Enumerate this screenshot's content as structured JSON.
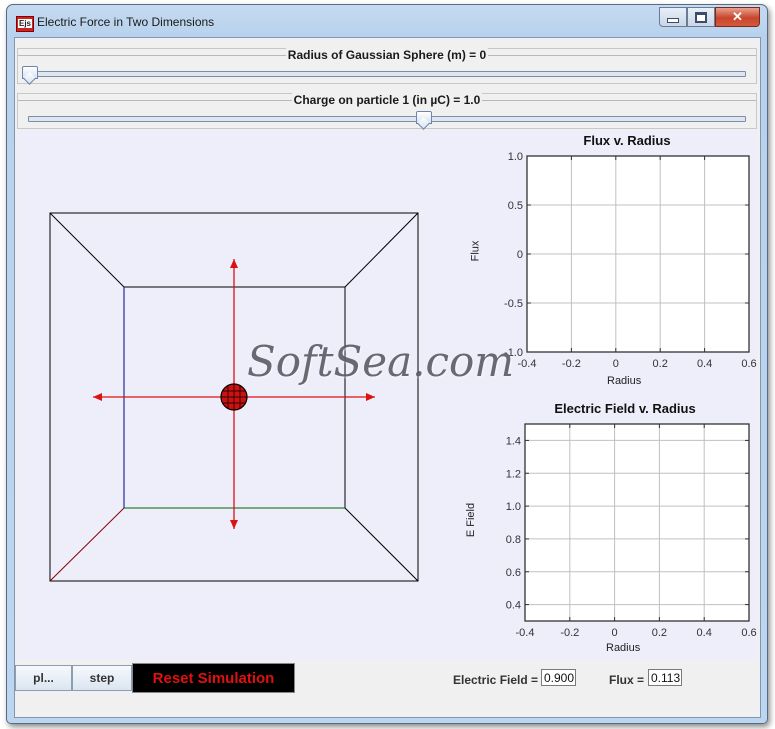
{
  "window": {
    "title": "Electric Force in Two Dimensions",
    "icon_label": "Ejs",
    "controls": {
      "minimize": "minimize-icon",
      "maximize": "maximize-icon",
      "close": "close-icon",
      "close_glyph": "✕"
    }
  },
  "sliders": [
    {
      "label": "Radius of Gaussian Sphere (m) = 0",
      "value": 0,
      "position_fraction": 0.0
    },
    {
      "label": "Charge on particle 1 (in µC) = 1.0",
      "value": 1.0,
      "position_fraction": 0.55
    }
  ],
  "simulation": {
    "particle_color": "#cc1111",
    "arrow_color": "#dd1111",
    "arrows": [
      "up",
      "down",
      "left",
      "right"
    ]
  },
  "chart_data": [
    {
      "type": "line",
      "title": "Flux v. Radius",
      "xlabel": "Radius",
      "ylabel": "Flux",
      "xlim": [
        -0.4,
        0.6
      ],
      "ylim": [
        -1.0,
        1.0
      ],
      "x_ticks": [
        "-0.4",
        "-0.2",
        "0",
        "0.2",
        "0.4",
        "0.6"
      ],
      "y_ticks": [
        "1.0",
        "0.5",
        "0",
        "-0.5",
        "-1.0"
      ],
      "grid": true,
      "series": []
    },
    {
      "type": "line",
      "title": "Electric Field v. Radius",
      "xlabel": "Radius",
      "ylabel": "E Field",
      "xlim": [
        -0.4,
        0.6
      ],
      "ylim": [
        0.3,
        1.5
      ],
      "x_ticks": [
        "-0.4",
        "-0.2",
        "0",
        "0.2",
        "0.4",
        "0.6"
      ],
      "y_ticks": [
        "1.4",
        "1.2",
        "1.0",
        "0.8",
        "0.6",
        "0.4"
      ],
      "grid": true,
      "series": []
    }
  ],
  "controls": {
    "play_label": "pl...",
    "step_label": "step",
    "reset_label": "Reset Simulation",
    "efield_label": "Electric Field =",
    "efield_value": "0.900",
    "flux_label": "Flux =",
    "flux_value": "0.113"
  },
  "watermark": "SoftSea.com"
}
